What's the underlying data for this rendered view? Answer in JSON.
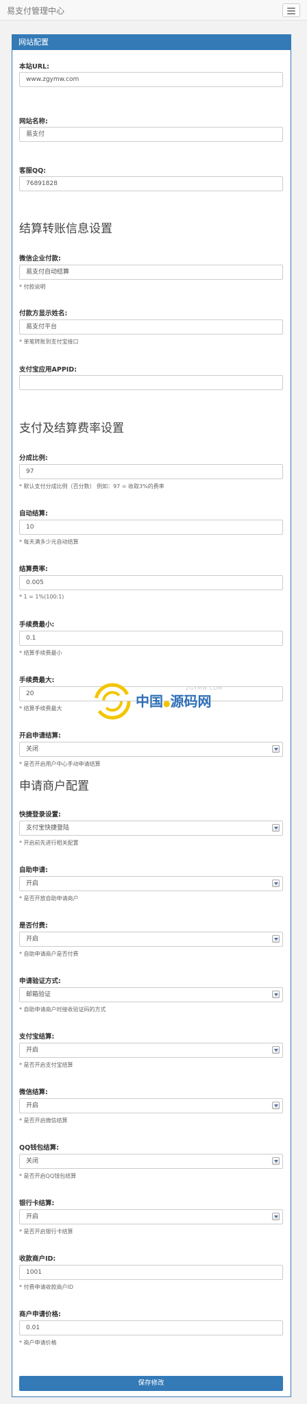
{
  "navbar": {
    "brand": "易支付管理中心"
  },
  "panel": {
    "heading": "网站配置"
  },
  "fields": [
    {
      "label": "本站URL:",
      "value": "www.zgymw.com"
    },
    {
      "label": "网站名称:",
      "value": "易支付"
    },
    {
      "label": "客服QQ:",
      "value": "76891828"
    },
    {
      "label": "微信企业付款:",
      "value": "易支付自动结算",
      "help": "* 付款说明"
    },
    {
      "label": "付款方显示姓名:",
      "value": "易支付平台",
      "help": "* 单笔转账到支付宝接口"
    },
    {
      "label": "支付宝应用APPID:",
      "value": ""
    },
    {
      "label": "分成比例:",
      "value": "97",
      "help": "* 默认支付分成比例（百分数） 例如：97 = 收取3%的费率"
    },
    {
      "label": "自动结算:",
      "value": "10",
      "help": "* 每天满多少元自动结算"
    },
    {
      "label": "结算费率:",
      "value": "0.005",
      "help": "* 1 = 1%(100:1)"
    },
    {
      "label": "手续费最小:",
      "value": "0.1",
      "help": "* 结算手续费最小"
    },
    {
      "label": "手续费最大:",
      "value": "20",
      "help": "* 结算手续费最大"
    },
    {
      "label": "开启申请结算:",
      "value": "关闭",
      "help": "* 是否开启用户中心手动申请结算"
    },
    {
      "label": "快捷登录设置:",
      "value": "支付宝快捷登陆",
      "help": "* 开启前先进行相关配置"
    },
    {
      "label": "自助申请:",
      "value": "开启",
      "help": "* 是否开放自助申请商户"
    },
    {
      "label": "是否付费:",
      "value": "开启",
      "help": "* 自助申请商户是否付费"
    },
    {
      "label": "申请验证方式:",
      "value": "邮箱验证",
      "help": "* 自助申请商户时接收验证码的方式"
    },
    {
      "label": "支付宝结算:",
      "value": "开启",
      "help": "* 是否开启支付宝结算"
    },
    {
      "label": "微信结算:",
      "value": "开启",
      "help": "* 是否开启微信结算"
    },
    {
      "label": "QQ钱包结算:",
      "value": "关闭",
      "help": "* 是否开启QQ钱包结算"
    },
    {
      "label": "银行卡结算:",
      "value": "开启",
      "help": "* 是否开启银行卡结算"
    },
    {
      "label": "收款商户ID:",
      "value": "1001",
      "help": "* 付费申请收款商户ID"
    },
    {
      "label": "商户申请价格:",
      "value": "0.01",
      "help": "* 商户申请价格"
    }
  ],
  "sections": [
    "结算转账信息设置",
    "支付及结算费率设置",
    "申请商户配置"
  ],
  "save_label": "保存修改",
  "watermark": {
    "text_cn1": "中国",
    "text_cn2": "源码网",
    "text_en": "ZGYMW.COM"
  },
  "colors": {
    "primary": "#337ab7",
    "wm_blue": "#2f6fb7",
    "wm_yellow": "#f3c500"
  }
}
